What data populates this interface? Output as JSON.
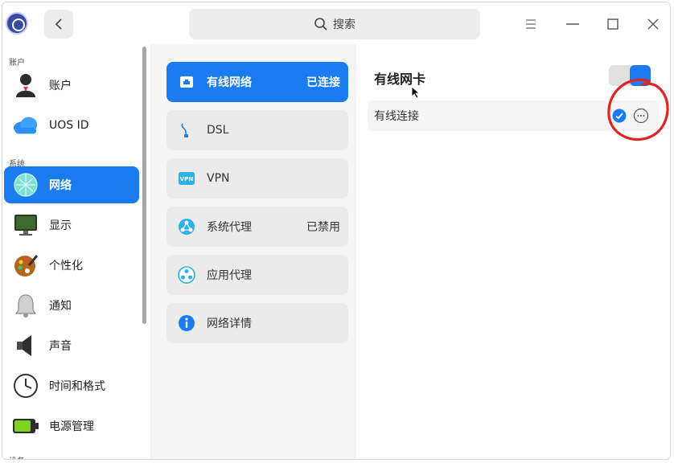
{
  "header": {
    "search_label": "搜索"
  },
  "sidebar": {
    "sections": [
      "账户",
      "系统",
      "设备"
    ],
    "items": [
      {
        "label": "账户",
        "icon": "user-avatar-icon"
      },
      {
        "label": "UOS ID",
        "icon": "cloud-icon"
      },
      {
        "label": "网络",
        "icon": "network-globe-icon",
        "active": true
      },
      {
        "label": "显示",
        "icon": "display-monitor-icon"
      },
      {
        "label": "个性化",
        "icon": "palette-icon"
      },
      {
        "label": "通知",
        "icon": "bell-icon"
      },
      {
        "label": "声音",
        "icon": "speaker-icon"
      },
      {
        "label": "时间和格式",
        "icon": "clock-icon"
      },
      {
        "label": "电源管理",
        "icon": "battery-icon"
      }
    ]
  },
  "network_menu": {
    "items": [
      {
        "label": "有线网络",
        "status": "已连接",
        "icon": "wired-network-icon",
        "active": true
      },
      {
        "label": "DSL",
        "status": "",
        "icon": "dsl-plug-icon"
      },
      {
        "label": "VPN",
        "status": "",
        "icon": "vpn-icon"
      },
      {
        "label": "系统代理",
        "status": "已禁用",
        "icon": "system-proxy-icon"
      },
      {
        "label": "应用代理",
        "status": "",
        "icon": "app-proxy-icon"
      },
      {
        "label": "网络详情",
        "status": "",
        "icon": "info-icon"
      }
    ]
  },
  "detail": {
    "title": "有线网卡",
    "toggle_on": true,
    "connection_label": "有线连接",
    "connected": true
  },
  "colors": {
    "accent": "#1a7cf0",
    "annotation": "#e0241f"
  }
}
